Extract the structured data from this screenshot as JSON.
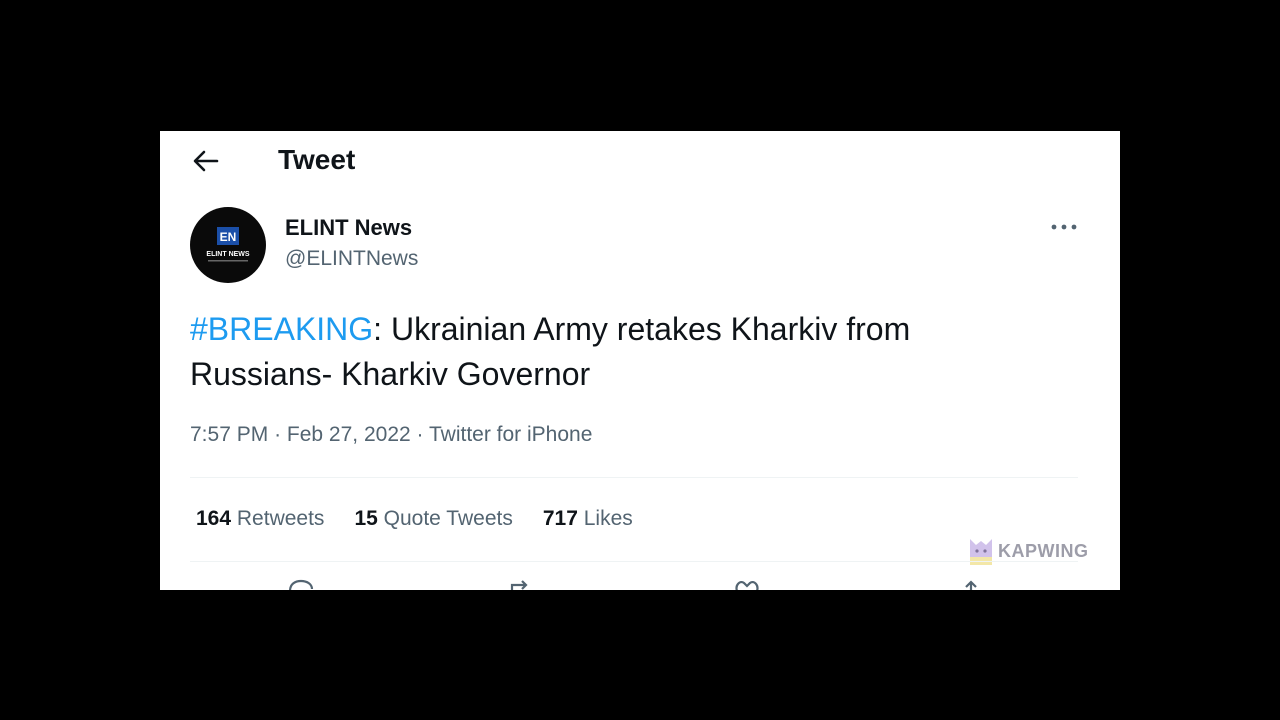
{
  "header": {
    "title": "Tweet"
  },
  "author": {
    "display_name": "ELINT News",
    "handle": "@ELINTNews",
    "avatar_initials": "EN",
    "avatar_caption": "ELINT NEWS"
  },
  "tweet": {
    "hashtag": "#BREAKING",
    "text": ": Ukrainian Army retakes Kharkiv from Russians- Kharkiv Governor",
    "time": "7:57 PM",
    "separator": "·",
    "date": "Feb 27, 2022",
    "source": "Twitter for iPhone"
  },
  "stats": {
    "retweets_count": "164",
    "retweets_label": "Retweets",
    "quotes_count": "15",
    "quotes_label": "Quote Tweets",
    "likes_count": "717",
    "likes_label": "Likes"
  },
  "watermark": {
    "text": "KAPWING"
  },
  "colors": {
    "hashtag": "#1d9bf0",
    "secondary_text": "#536471",
    "primary_text": "#0f1419"
  }
}
